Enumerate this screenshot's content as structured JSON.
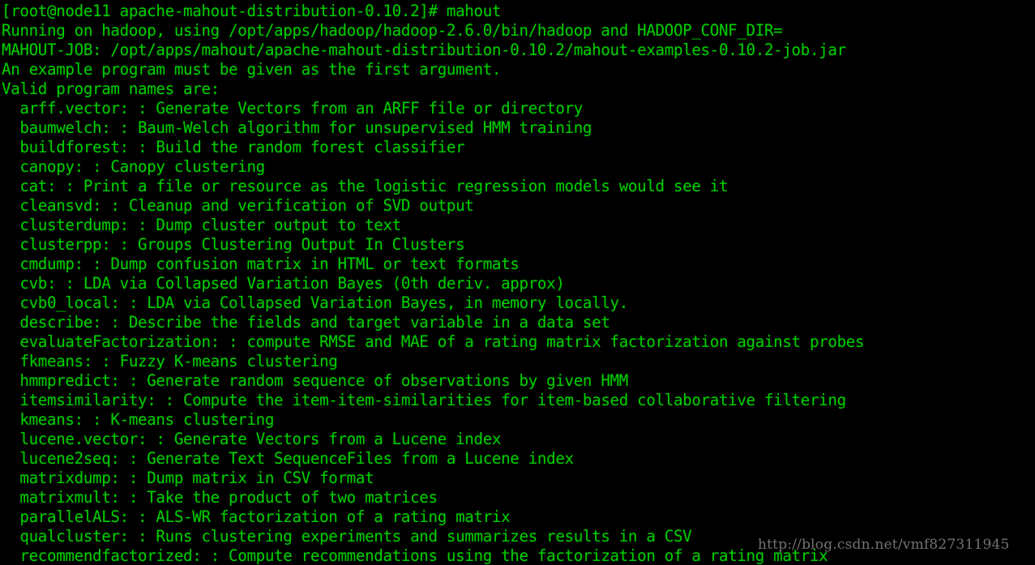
{
  "terminal": {
    "background_color": "#000000",
    "foreground_color": "#00cc00",
    "watermark_color": "#8c8c8c",
    "prompt": {
      "user": "root",
      "host": "node11",
      "cwd": "apache-mahout-distribution-0.10.2",
      "symbol": "#",
      "command": "mahout",
      "full_line": "[root@node11 apache-mahout-distribution-0.10.2]# mahout"
    },
    "watermark": "http://blog.csdn.net/vmf827311945",
    "header_lines": [
      "[root@node11 apache-mahout-distribution-0.10.2]# mahout",
      "Running on hadoop, using /opt/apps/hadoop/hadoop-2.6.0/bin/hadoop and HADOOP_CONF_DIR=",
      "MAHOUT-JOB: /opt/apps/mahout/apache-mahout-distribution-0.10.2/mahout-examples-0.10.2-job.jar",
      "An example program must be given as the first argument.",
      "Valid program names are:"
    ],
    "programs": [
      {
        "name": "arff.vector",
        "description": "Generate Vectors from an ARFF file or directory"
      },
      {
        "name": "baumwelch",
        "description": "Baum-Welch algorithm for unsupervised HMM training"
      },
      {
        "name": "buildforest",
        "description": "Build the random forest classifier"
      },
      {
        "name": "canopy",
        "description": "Canopy clustering"
      },
      {
        "name": "cat",
        "description": "Print a file or resource as the logistic regression models would see it"
      },
      {
        "name": "cleansvd",
        "description": "Cleanup and verification of SVD output"
      },
      {
        "name": "clusterdump",
        "description": "Dump cluster output to text"
      },
      {
        "name": "clusterpp",
        "description": "Groups Clustering Output In Clusters"
      },
      {
        "name": "cmdump",
        "description": "Dump confusion matrix in HTML or text formats"
      },
      {
        "name": "cvb",
        "description": "LDA via Collapsed Variation Bayes (0th deriv. approx)"
      },
      {
        "name": "cvb0_local",
        "description": "LDA via Collapsed Variation Bayes, in memory locally."
      },
      {
        "name": "describe",
        "description": "Describe the fields and target variable in a data set"
      },
      {
        "name": "evaluateFactorization",
        "description": "compute RMSE and MAE of a rating matrix factorization against probes"
      },
      {
        "name": "fkmeans",
        "description": "Fuzzy K-means clustering"
      },
      {
        "name": "hmmpredict",
        "description": "Generate random sequence of observations by given HMM"
      },
      {
        "name": "itemsimilarity",
        "description": "Compute the item-item-similarities for item-based collaborative filtering"
      },
      {
        "name": "kmeans",
        "description": "K-means clustering"
      },
      {
        "name": "lucene.vector",
        "description": "Generate Vectors from a Lucene index"
      },
      {
        "name": "lucene2seq",
        "description": "Generate Text SequenceFiles from a Lucene index"
      },
      {
        "name": "matrixdump",
        "description": "Dump matrix in CSV format"
      },
      {
        "name": "matrixmult",
        "description": "Take the product of two matrices"
      },
      {
        "name": "parallelALS",
        "description": "ALS-WR factorization of a rating matrix"
      },
      {
        "name": "qualcluster",
        "description": "Runs clustering experiments and summarizes results in a CSV"
      },
      {
        "name": "recommendfactorized",
        "description": "Compute recommendations using the factorization of a rating matrix"
      }
    ],
    "program_indent": "  ",
    "program_separator": ": : ",
    "lines": [
      "[root@node11 apache-mahout-distribution-0.10.2]# mahout",
      "Running on hadoop, using /opt/apps/hadoop/hadoop-2.6.0/bin/hadoop and HADOOP_CONF_DIR=",
      "MAHOUT-JOB: /opt/apps/mahout/apache-mahout-distribution-0.10.2/mahout-examples-0.10.2-job.jar",
      "An example program must be given as the first argument.",
      "Valid program names are:",
      "  arff.vector: : Generate Vectors from an ARFF file or directory",
      "  baumwelch: : Baum-Welch algorithm for unsupervised HMM training",
      "  buildforest: : Build the random forest classifier",
      "  canopy: : Canopy clustering",
      "  cat: : Print a file or resource as the logistic regression models would see it",
      "  cleansvd: : Cleanup and verification of SVD output",
      "  clusterdump: : Dump cluster output to text",
      "  clusterpp: : Groups Clustering Output In Clusters",
      "  cmdump: : Dump confusion matrix in HTML or text formats",
      "  cvb: : LDA via Collapsed Variation Bayes (0th deriv. approx)",
      "  cvb0_local: : LDA via Collapsed Variation Bayes, in memory locally.",
      "  describe: : Describe the fields and target variable in a data set",
      "  evaluateFactorization: : compute RMSE and MAE of a rating matrix factorization against probes",
      "  fkmeans: : Fuzzy K-means clustering",
      "  hmmpredict: : Generate random sequence of observations by given HMM",
      "  itemsimilarity: : Compute the item-item-similarities for item-based collaborative filtering",
      "  kmeans: : K-means clustering",
      "  lucene.vector: : Generate Vectors from a Lucene index",
      "  lucene2seq: : Generate Text SequenceFiles from a Lucene index",
      "  matrixdump: : Dump matrix in CSV format",
      "  matrixmult: : Take the product of two matrices",
      "  parallelALS: : ALS-WR factorization of a rating matrix",
      "  qualcluster: : Runs clustering experiments and summarizes results in a CSV",
      "  recommendfactorized: : Compute recommendations using the factorization of a rating matrix"
    ]
  }
}
